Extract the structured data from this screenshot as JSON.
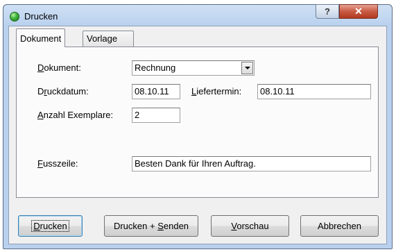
{
  "window": {
    "title": "Drucken",
    "help_glyph": "?",
    "close_glyph": "✕"
  },
  "tabs": [
    {
      "label": "Dokument",
      "active": true
    },
    {
      "label": "Vorlage",
      "active": false
    }
  ],
  "form": {
    "dokument": {
      "label_mnemonic": "D",
      "label_rest": "okument:",
      "value": "Rechnung"
    },
    "druckdatum": {
      "label_pre": "D",
      "label_mnemonic": "r",
      "label_rest": "uckdatum:",
      "value": "08.10.11"
    },
    "liefertermin": {
      "label_mnemonic": "L",
      "label_rest": "iefertermin:",
      "value": "08.10.11"
    },
    "anzahl": {
      "label_mnemonic": "A",
      "label_rest": "nzahl Exemplare:",
      "value": "2"
    },
    "fusszeile": {
      "label_mnemonic": "F",
      "label_rest": "usszeile:",
      "value": "Besten Dank für Ihren Auftrag."
    }
  },
  "buttons": {
    "drucken": {
      "label_mnemonic": "D",
      "label_rest": "rucken"
    },
    "drucken_senden": {
      "label_pre": "Drucken + ",
      "label_mnemonic": "S",
      "label_rest": "enden"
    },
    "vorschau": {
      "label_mnemonic": "V",
      "label_rest": "orschau"
    },
    "abbrechen": {
      "label": "Abbrechen"
    }
  },
  "colors": {
    "frame": "#b9d1ee",
    "client": "#f0f0f0",
    "close_button": "#c95a44"
  }
}
